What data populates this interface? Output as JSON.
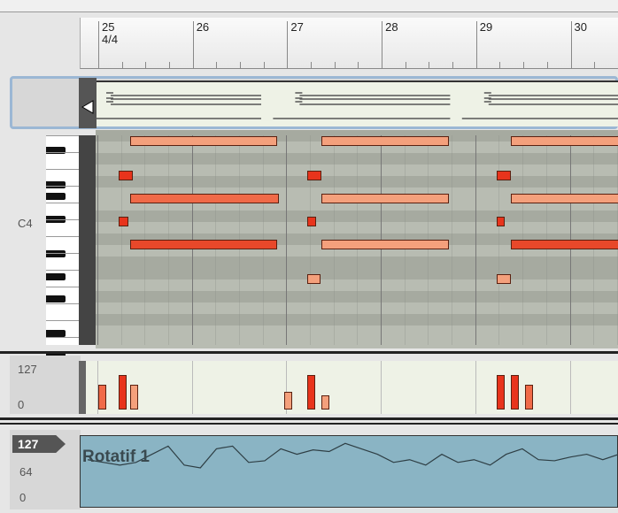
{
  "ruler": {
    "bars": [
      "25",
      "26",
      "27",
      "28",
      "29",
      "30"
    ],
    "time_signature": "4/4"
  },
  "keyboard": {
    "c4_label": "C4"
  },
  "notes": [
    {
      "row": 0,
      "start": 1.4,
      "len": 6.2,
      "color": "#f4a07c"
    },
    {
      "row": 3,
      "start": 0.9,
      "len": 0.6,
      "color": "#e8341c"
    },
    {
      "row": 5,
      "start": 1.4,
      "len": 6.3,
      "color": "#f06a48"
    },
    {
      "row": 7,
      "start": 0.9,
      "len": 0.4,
      "color": "#e8341c"
    },
    {
      "row": 9,
      "start": 1.4,
      "len": 6.2,
      "color": "#e8482a"
    },
    {
      "row": 0,
      "start": 9.5,
      "len": 5.4,
      "color": "#f4a07c"
    },
    {
      "row": 3,
      "start": 8.9,
      "len": 0.6,
      "color": "#e8341c"
    },
    {
      "row": 5,
      "start": 9.5,
      "len": 5.4,
      "color": "#f4a07c"
    },
    {
      "row": 7,
      "start": 8.9,
      "len": 0.35,
      "color": "#e8341c"
    },
    {
      "row": 9,
      "start": 9.5,
      "len": 5.4,
      "color": "#f4a07c"
    },
    {
      "row": 12,
      "start": 8.9,
      "len": 0.55,
      "color": "#f4a07c"
    },
    {
      "row": 0,
      "start": 17.5,
      "len": 5,
      "color": "#f4a07c"
    },
    {
      "row": 3,
      "start": 16.9,
      "len": 0.6,
      "color": "#e8341c"
    },
    {
      "row": 5,
      "start": 17.5,
      "len": 5,
      "color": "#f4a07c"
    },
    {
      "row": 7,
      "start": 16.9,
      "len": 0.35,
      "color": "#e8341c"
    },
    {
      "row": 9,
      "start": 17.5,
      "len": 5,
      "color": "#e8482a"
    },
    {
      "row": 12,
      "start": 16.9,
      "len": 0.6,
      "color": "#f4a07c"
    }
  ],
  "velocity": {
    "max_label": "127",
    "min_label": "0",
    "events": [
      {
        "beat": 0.05,
        "v": 70,
        "color": "#f06a48"
      },
      {
        "beat": 0.9,
        "v": 100,
        "color": "#e8341c"
      },
      {
        "beat": 1.4,
        "v": 70,
        "color": "#f4a07c"
      },
      {
        "beat": 7.9,
        "v": 50,
        "color": "#f4a07c"
      },
      {
        "beat": 8.9,
        "v": 100,
        "color": "#e8341c"
      },
      {
        "beat": 9.5,
        "v": 40,
        "color": "#f4a07c"
      },
      {
        "beat": 16.9,
        "v": 100,
        "color": "#e8341c"
      },
      {
        "beat": 17.5,
        "v": 100,
        "color": "#e8341c"
      },
      {
        "beat": 18.1,
        "v": 70,
        "color": "#f06a48"
      }
    ]
  },
  "automation": {
    "current_value": "127",
    "mid_label": "64",
    "min_label": "0",
    "name": "Rotatif 1",
    "values": [
      90,
      85,
      80,
      85,
      100,
      115,
      80,
      75,
      110,
      115,
      85,
      88,
      110,
      100,
      108,
      105,
      120,
      110,
      100,
      85,
      90,
      80,
      100,
      85,
      90,
      80,
      100,
      110,
      90,
      88,
      95,
      100,
      90,
      100
    ]
  }
}
